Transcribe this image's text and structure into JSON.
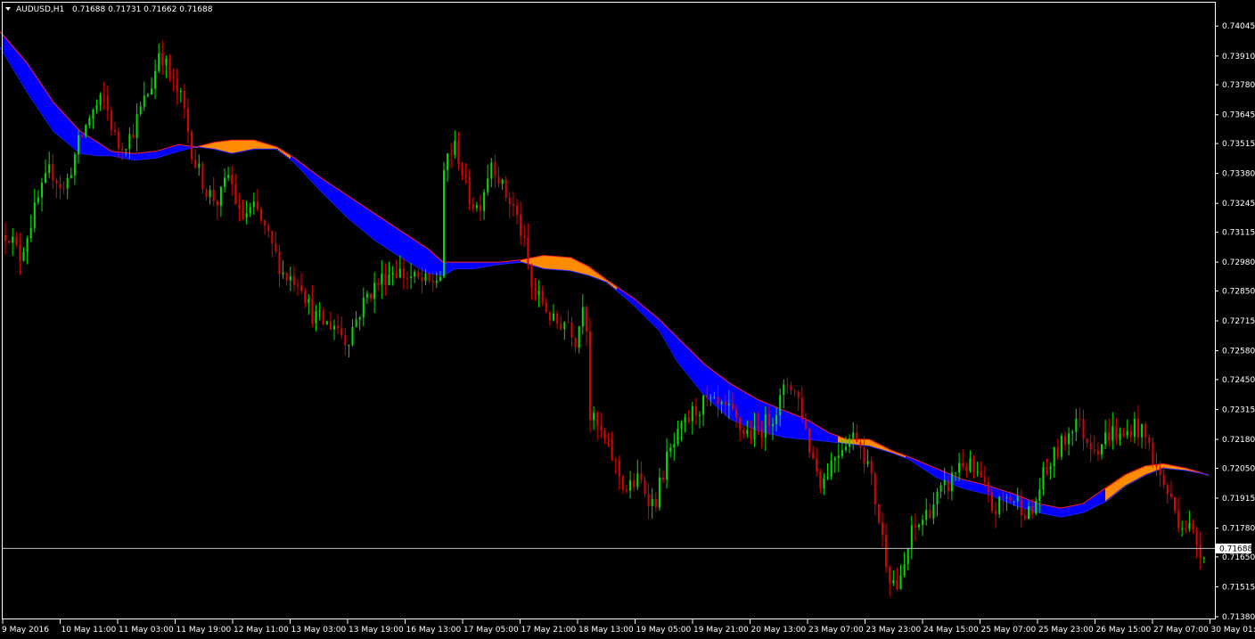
{
  "header": {
    "menu_icon": "triangle-down-icon",
    "symbol": "AUDUSD,H1",
    "ohlc": "0.71688 0.71731 0.71662 0.71688"
  },
  "colors": {
    "background": "#000000",
    "frame": "#ffffff",
    "bull": "#00e000",
    "bear": "#e00000",
    "cloud_down": "#0000ff",
    "cloud_up": "#ff8c00",
    "cloud_edge_red": "#ff2020",
    "cloud_edge_blue": "#2020ff",
    "price_line": "#c0c0c0",
    "price_tag_bg": "#ffffff",
    "price_tag_text": "#000000"
  },
  "chart_data": {
    "type": "candlestick",
    "ylim": [
      0.7138,
      0.7405
    ],
    "y_ticks": [
      "0.74045",
      "0.73910",
      "0.73780",
      "0.73645",
      "0.73515",
      "0.73380",
      "0.73245",
      "0.73115",
      "0.72980",
      "0.72850",
      "0.72715",
      "0.72580",
      "0.72450",
      "0.72315",
      "0.72180",
      "0.72050",
      "0.71915",
      "0.71780",
      "0.71650",
      "0.71515",
      "0.71380"
    ],
    "x_ticks": [
      "9 May 2016",
      "10 May 11:00",
      "11 May 03:00",
      "11 May 19:00",
      "12 May 11:00",
      "13 May 03:00",
      "13 May 19:00",
      "16 May 13:00",
      "17 May 05:00",
      "17 May 21:00",
      "18 May 13:00",
      "19 May 05:00",
      "19 May 21:00",
      "20 May 13:00",
      "23 May 07:00",
      "23 May 23:00",
      "24 May 15:00",
      "25 May 07:00",
      "25 May 23:00",
      "26 May 15:00",
      "27 May 07:00",
      "30 May 01:00"
    ],
    "current_price": 0.71688,
    "current_price_label": "0.71688",
    "anchors": [
      [
        0,
        0.7309
      ],
      [
        12,
        0.7312
      ],
      [
        25,
        0.73
      ],
      [
        45,
        0.7325
      ],
      [
        60,
        0.734
      ],
      [
        75,
        0.733
      ],
      [
        90,
        0.735
      ],
      [
        105,
        0.7365
      ],
      [
        120,
        0.7372
      ],
      [
        135,
        0.735
      ],
      [
        150,
        0.7355
      ],
      [
        162,
        0.7368
      ],
      [
        175,
        0.738
      ],
      [
        182,
        0.7395
      ],
      [
        195,
        0.738
      ],
      [
        208,
        0.737
      ],
      [
        220,
        0.7345
      ],
      [
        235,
        0.733
      ],
      [
        248,
        0.7325
      ],
      [
        260,
        0.7338
      ],
      [
        272,
        0.7318
      ],
      [
        290,
        0.7322
      ],
      [
        308,
        0.7305
      ],
      [
        322,
        0.7292
      ],
      [
        340,
        0.729
      ],
      [
        352,
        0.7275
      ],
      [
        368,
        0.727
      ],
      [
        380,
        0.727
      ],
      [
        392,
        0.7262
      ],
      [
        400,
        0.727
      ],
      [
        415,
        0.7283
      ],
      [
        430,
        0.729
      ],
      [
        445,
        0.7295
      ],
      [
        458,
        0.7292
      ],
      [
        470,
        0.729
      ],
      [
        485,
        0.7288
      ],
      [
        497,
        0.7292
      ],
      [
        502,
        0.7345
      ],
      [
        515,
        0.735
      ],
      [
        528,
        0.7328
      ],
      [
        540,
        0.7322
      ],
      [
        555,
        0.7345
      ],
      [
        568,
        0.733
      ],
      [
        580,
        0.7322
      ],
      [
        590,
        0.7308
      ],
      [
        600,
        0.7285
      ],
      [
        612,
        0.728
      ],
      [
        625,
        0.727
      ],
      [
        640,
        0.7272
      ],
      [
        650,
        0.7262
      ],
      [
        660,
        0.729
      ],
      [
        663,
        0.723
      ],
      [
        675,
        0.7222
      ],
      [
        690,
        0.721
      ],
      [
        705,
        0.7195
      ],
      [
        720,
        0.72
      ],
      [
        737,
        0.7188
      ],
      [
        750,
        0.7208
      ],
      [
        765,
        0.722
      ],
      [
        780,
        0.723
      ],
      [
        795,
        0.7235
      ],
      [
        808,
        0.7232
      ],
      [
        822,
        0.723
      ],
      [
        835,
        0.7222
      ],
      [
        850,
        0.722
      ],
      [
        862,
        0.7225
      ],
      [
        875,
        0.7232
      ],
      [
        888,
        0.7245
      ],
      [
        900,
        0.7235
      ],
      [
        912,
        0.7213
      ],
      [
        925,
        0.7198
      ],
      [
        938,
        0.721
      ],
      [
        952,
        0.7218
      ],
      [
        965,
        0.722
      ],
      [
        978,
        0.7205
      ],
      [
        990,
        0.718
      ],
      [
        1000,
        0.7158
      ],
      [
        1012,
        0.715
      ],
      [
        1025,
        0.7175
      ],
      [
        1040,
        0.7183
      ],
      [
        1055,
        0.7192
      ],
      [
        1068,
        0.7198
      ],
      [
        1080,
        0.7208
      ],
      [
        1092,
        0.7205
      ],
      [
        1105,
        0.7198
      ],
      [
        1118,
        0.7185
      ],
      [
        1130,
        0.7192
      ],
      [
        1145,
        0.719
      ],
      [
        1160,
        0.7183
      ],
      [
        1172,
        0.72
      ],
      [
        1185,
        0.721
      ],
      [
        1198,
        0.7218
      ],
      [
        1210,
        0.7228
      ],
      [
        1222,
        0.7218
      ],
      [
        1235,
        0.7215
      ],
      [
        1250,
        0.7222
      ],
      [
        1262,
        0.7218
      ],
      [
        1275,
        0.7225
      ],
      [
        1290,
        0.7218
      ],
      [
        1300,
        0.7205
      ],
      [
        1312,
        0.7195
      ],
      [
        1325,
        0.7182
      ],
      [
        1338,
        0.7178
      ],
      [
        1350,
        0.7168
      ]
    ],
    "band_upper": [
      [
        0,
        0.7402
      ],
      [
        30,
        0.7388
      ],
      [
        60,
        0.737
      ],
      [
        90,
        0.7357
      ],
      [
        110,
        0.7352
      ],
      [
        125,
        0.7348
      ],
      [
        150,
        0.7347
      ],
      [
        175,
        0.7348
      ],
      [
        200,
        0.7351
      ],
      [
        220,
        0.735
      ],
      [
        240,
        0.7352
      ],
      [
        260,
        0.7353
      ],
      [
        285,
        0.7353
      ],
      [
        310,
        0.735
      ],
      [
        330,
        0.7345
      ],
      [
        360,
        0.7336
      ],
      [
        390,
        0.7328
      ],
      [
        420,
        0.732
      ],
      [
        450,
        0.7312
      ],
      [
        480,
        0.7304
      ],
      [
        497,
        0.7298
      ],
      [
        510,
        0.7298
      ],
      [
        530,
        0.7298
      ],
      [
        560,
        0.7298
      ],
      [
        585,
        0.7299
      ],
      [
        610,
        0.7301
      ],
      [
        640,
        0.73
      ],
      [
        660,
        0.7296
      ],
      [
        680,
        0.729
      ],
      [
        710,
        0.7282
      ],
      [
        740,
        0.7272
      ],
      [
        760,
        0.7264
      ],
      [
        790,
        0.7252
      ],
      [
        820,
        0.7243
      ],
      [
        850,
        0.7236
      ],
      [
        880,
        0.7231
      ],
      [
        905,
        0.7227
      ],
      [
        930,
        0.7221
      ],
      [
        950,
        0.7218
      ],
      [
        975,
        0.7218
      ],
      [
        1000,
        0.7213
      ],
      [
        1020,
        0.721
      ],
      [
        1050,
        0.7205
      ],
      [
        1080,
        0.72
      ],
      [
        1110,
        0.7197
      ],
      [
        1140,
        0.7193
      ],
      [
        1165,
        0.7189
      ],
      [
        1190,
        0.7187
      ],
      [
        1215,
        0.7189
      ],
      [
        1240,
        0.7196
      ],
      [
        1262,
        0.7202
      ],
      [
        1285,
        0.7206
      ],
      [
        1305,
        0.7207
      ],
      [
        1330,
        0.7205
      ],
      [
        1356,
        0.7202
      ]
    ],
    "band_lower": [
      [
        0,
        0.7395
      ],
      [
        30,
        0.7375
      ],
      [
        60,
        0.7357
      ],
      [
        90,
        0.7347
      ],
      [
        110,
        0.7346
      ],
      [
        125,
        0.7346
      ],
      [
        150,
        0.7344
      ],
      [
        175,
        0.7345
      ],
      [
        200,
        0.7348
      ],
      [
        220,
        0.735
      ],
      [
        240,
        0.7349
      ],
      [
        260,
        0.7347
      ],
      [
        285,
        0.7349
      ],
      [
        310,
        0.7349
      ],
      [
        330,
        0.7343
      ],
      [
        360,
        0.733
      ],
      [
        390,
        0.7318
      ],
      [
        420,
        0.7308
      ],
      [
        450,
        0.73
      ],
      [
        480,
        0.7293
      ],
      [
        497,
        0.7292
      ],
      [
        510,
        0.7295
      ],
      [
        530,
        0.7295
      ],
      [
        560,
        0.7297
      ],
      [
        585,
        0.7298
      ],
      [
        610,
        0.7295
      ],
      [
        640,
        0.7294
      ],
      [
        660,
        0.7292
      ],
      [
        680,
        0.7289
      ],
      [
        710,
        0.7279
      ],
      [
        740,
        0.7267
      ],
      [
        760,
        0.7253
      ],
      [
        790,
        0.7238
      ],
      [
        820,
        0.7227
      ],
      [
        850,
        0.7222
      ],
      [
        880,
        0.7219
      ],
      [
        905,
        0.7218
      ],
      [
        930,
        0.7217
      ],
      [
        950,
        0.7216
      ],
      [
        975,
        0.7215
      ],
      [
        1000,
        0.7212
      ],
      [
        1020,
        0.7209
      ],
      [
        1050,
        0.7201
      ],
      [
        1080,
        0.7196
      ],
      [
        1110,
        0.7193
      ],
      [
        1140,
        0.7188
      ],
      [
        1165,
        0.7185
      ],
      [
        1190,
        0.7183
      ],
      [
        1215,
        0.7185
      ],
      [
        1240,
        0.719
      ],
      [
        1262,
        0.7197
      ],
      [
        1285,
        0.7202
      ],
      [
        1305,
        0.7205
      ],
      [
        1330,
        0.7204
      ],
      [
        1356,
        0.7202
      ]
    ]
  }
}
